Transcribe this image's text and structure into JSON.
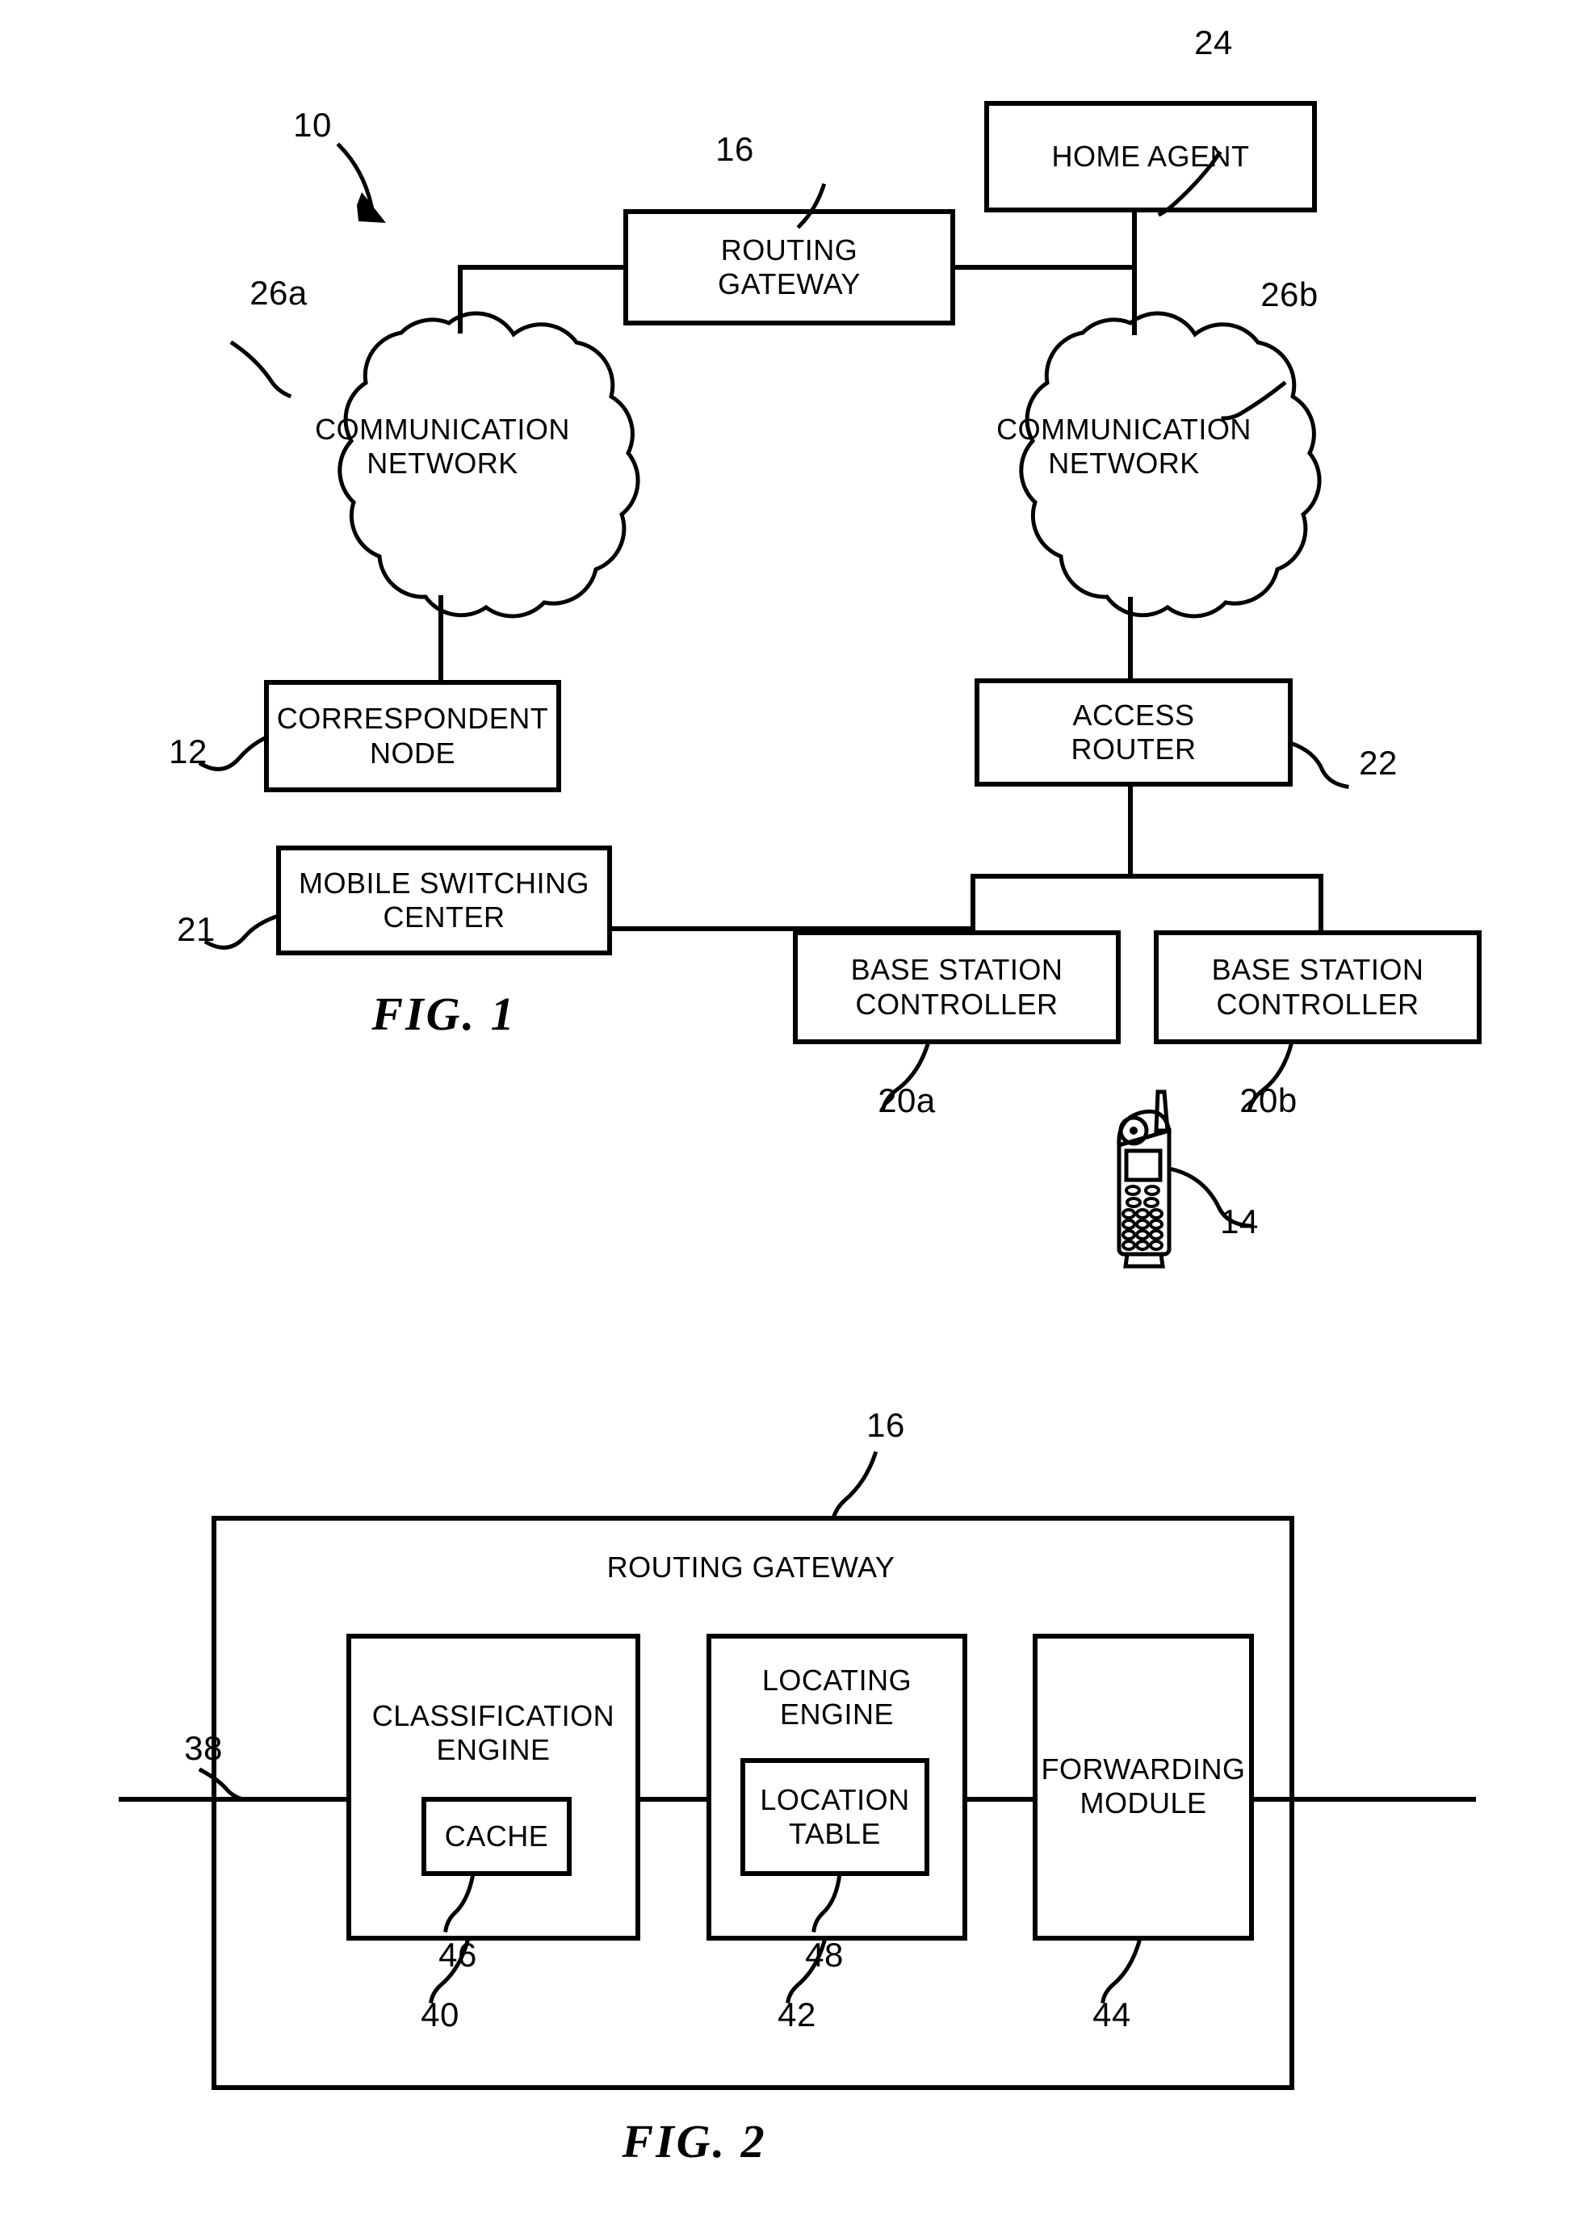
{
  "figures": [
    {
      "id": "fig1",
      "caption": "FIG.  1",
      "system_ref": "10",
      "nodes": {
        "home_agent": {
          "label": "HOME AGENT",
          "ref": "24"
        },
        "routing_gateway": {
          "label": "ROUTING\nGATEWAY",
          "ref": "16"
        },
        "network_left": {
          "label": "COMMUNICATION\nNETWORK",
          "ref": "26a"
        },
        "network_right": {
          "label": "COMMUNICATION\nNETWORK",
          "ref": "26b"
        },
        "correspondent_node": {
          "label": "CORRESPONDENT\nNODE",
          "ref": "12"
        },
        "access_router": {
          "label": "ACCESS\nROUTER",
          "ref": "22"
        },
        "mobile_switching_center": {
          "label": "MOBILE SWITCHING\nCENTER",
          "ref": "21"
        },
        "base_station_controller_a": {
          "label": "BASE STATION\nCONTROLLER",
          "ref": "20a"
        },
        "base_station_controller_b": {
          "label": "BASE STATION\nCONTROLLER",
          "ref": "20b"
        },
        "mobile_node": {
          "label": "",
          "ref": "14",
          "icon": "mobile-phone-icon"
        }
      }
    },
    {
      "id": "fig2",
      "caption": "FIG.  2",
      "title": "ROUTING GATEWAY",
      "title_ref": "16",
      "interface_ref": "38",
      "nodes": {
        "classification_engine": {
          "label": "CLASSIFICATION\nENGINE",
          "ref": "40"
        },
        "cache": {
          "label": "CACHE",
          "ref": "46"
        },
        "locating_engine": {
          "label": "LOCATING\nENGINE",
          "ref": "42"
        },
        "location_table": {
          "label": "LOCATION\nTABLE",
          "ref": "48"
        },
        "forwarding_module": {
          "label": "FORWARDING\nMODULE",
          "ref": "44"
        }
      }
    }
  ],
  "style": {
    "ink": "#000000",
    "paper": "#ffffff"
  }
}
